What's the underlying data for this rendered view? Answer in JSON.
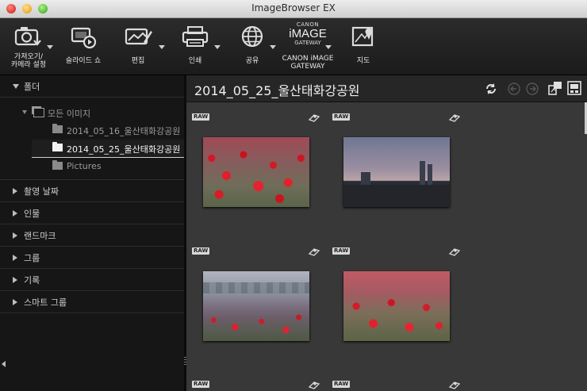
{
  "window": {
    "title": "ImageBrowser EX"
  },
  "toolbar": {
    "import": {
      "label_line1": "가져오기/",
      "label_line2": "카메라 설정",
      "icon": "camera-import-icon"
    },
    "slideshow": {
      "label": "슬라이드 쇼",
      "icon": "slideshow-icon"
    },
    "edit": {
      "label": "편집",
      "icon": "edit-image-icon"
    },
    "print": {
      "label": "인쇄",
      "icon": "printer-icon"
    },
    "share": {
      "label": "공유",
      "icon": "globe-share-icon"
    },
    "gateway": {
      "logo_top": "CANON",
      "logo_mid": "iMAGE",
      "logo_bottom": "GATEWAY",
      "label_line1": "CANON iMAGE",
      "label_line2": "GATEWAY",
      "icon": "canon-image-gateway-logo"
    },
    "map": {
      "label": "지도",
      "icon": "map-icon"
    }
  },
  "sidebar": {
    "folders_header": "폴더",
    "tree": {
      "root": "모든 이미지",
      "items": [
        {
          "label": "2014_05_16_울산태화강공원",
          "selected": false
        },
        {
          "label": "2014_05_25_울산태화강공원",
          "selected": true
        },
        {
          "label": "Pictures",
          "selected": false
        }
      ]
    },
    "sections": [
      "촬영 날짜",
      "인물",
      "랜드마크",
      "그룹",
      "기록",
      "스마트 그룹"
    ]
  },
  "main": {
    "title": "2014_05_25_울산태화강공원",
    "badge": "RAW",
    "thumbnails": [
      {
        "badge": "RAW",
        "scene": "poppy-field"
      },
      {
        "badge": "RAW",
        "scene": "city-sunset"
      },
      {
        "badge": "RAW",
        "scene": "misty-poppy-field"
      },
      {
        "badge": "RAW",
        "scene": "poppy-closeup"
      }
    ]
  },
  "colors": {
    "accent_selection": "#3a3a3a",
    "folder_white": "#f2f2f2",
    "folder_gray": "#8a8a8a"
  }
}
